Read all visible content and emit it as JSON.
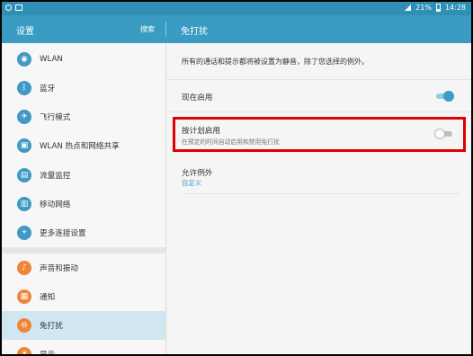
{
  "status_bar": {
    "left_icons": [
      "notification-icon",
      "screenshot-icon"
    ],
    "battery": "21%",
    "time": "14:28"
  },
  "header": {
    "title": "设置",
    "search_label": "搜索",
    "page_title": "免打扰"
  },
  "sidebar": {
    "items": [
      {
        "label": "WLAN",
        "icon": "wifi-icon",
        "glyph": "◉"
      },
      {
        "label": "蓝牙",
        "icon": "bluetooth-icon",
        "glyph": "ᛒ"
      },
      {
        "label": "飞行模式",
        "icon": "airplane-icon",
        "glyph": "✈"
      },
      {
        "label": "WLAN 热点和网络共享",
        "icon": "hotspot-icon",
        "glyph": "▣"
      },
      {
        "label": "流量监控",
        "icon": "data-usage-icon",
        "glyph": "▤"
      },
      {
        "label": "移动网络",
        "icon": "mobile-network-icon",
        "glyph": "▥"
      },
      {
        "label": "更多连接设置",
        "icon": "more-connections-icon",
        "glyph": "⌖"
      },
      {
        "label": "声音和振动",
        "icon": "sound-icon",
        "glyph": "♪"
      },
      {
        "label": "通知",
        "icon": "notification-icon",
        "glyph": "▦"
      },
      {
        "label": "免打扰",
        "icon": "do-not-disturb-icon",
        "glyph": "⊖"
      },
      {
        "label": "显示",
        "icon": "display-icon",
        "glyph": "☀"
      }
    ],
    "selected_index": 9
  },
  "content": {
    "description": "所有的通话和提示都将被设置为静音，除了您选择的例外。",
    "enable_now": {
      "label": "现在启用",
      "toggle": "on"
    },
    "schedule": {
      "label": "按计划启用",
      "sublabel": "在预定的时间自动启用和禁用免打扰",
      "toggle": "off"
    },
    "exceptions": {
      "label": "允许例外",
      "value": "自定义"
    }
  },
  "colors": {
    "accent": "#3a9bc3",
    "highlight": "#e00000",
    "orange": "#f08537"
  }
}
